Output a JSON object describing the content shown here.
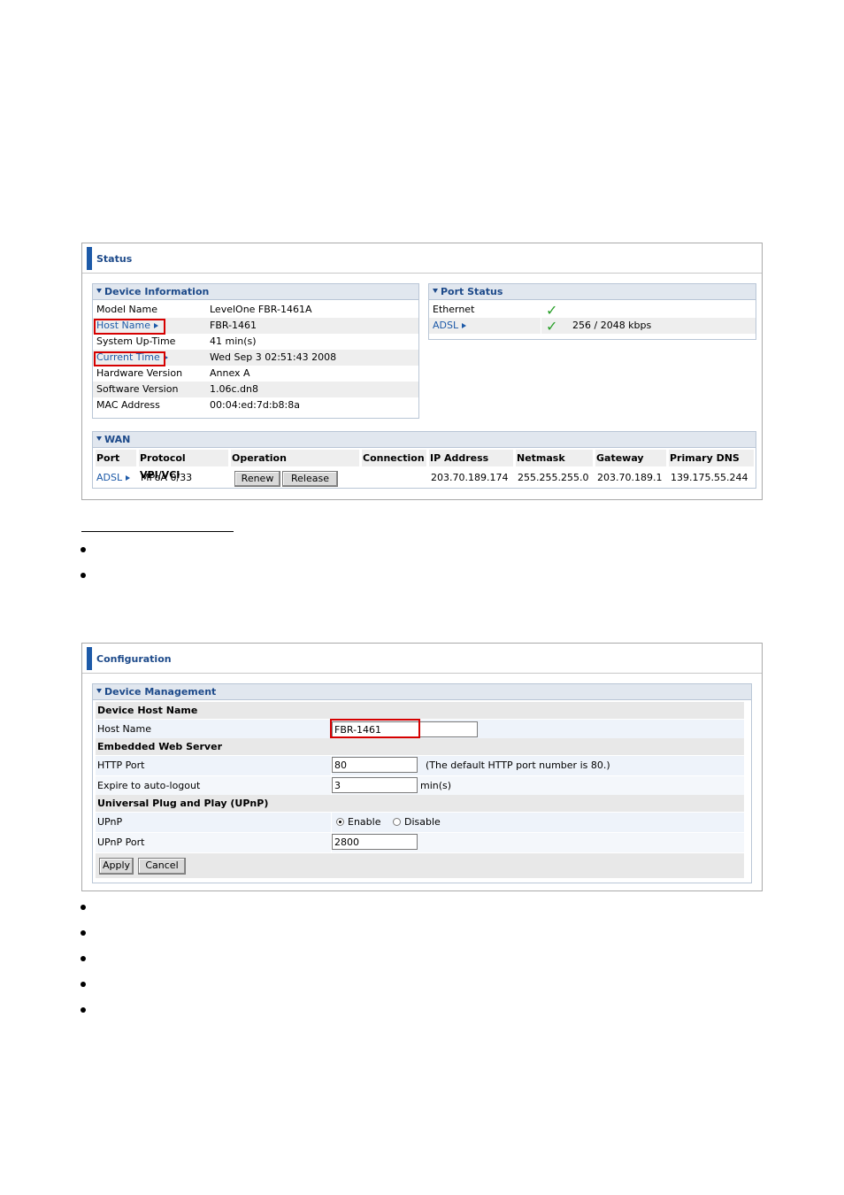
{
  "status_panel": {
    "title": "Status",
    "device_info": {
      "title": "Device Information",
      "rows": [
        {
          "label": "Model Name",
          "value": "LevelOne FBR-1461A"
        },
        {
          "label": "Host Name",
          "value": "FBR-1461"
        },
        {
          "label": "System Up-Time",
          "value": "41 min(s)"
        },
        {
          "label": "Current Time",
          "value": "Wed Sep 3 02:51:43 2008"
        },
        {
          "label": "Hardware Version",
          "value": "Annex A"
        },
        {
          "label": "Software Version",
          "value": "1.06c.dn8"
        },
        {
          "label": "MAC Address",
          "value": "00:04:ed:7d:b8:8a"
        }
      ]
    },
    "port_status": {
      "title": "Port Status",
      "rows": [
        {
          "label": "Ethernet",
          "value": ""
        },
        {
          "label": "ADSL",
          "value": "256 / 2048 kbps"
        }
      ],
      "check_glyph": "✓"
    },
    "wan": {
      "title": "WAN",
      "headers": [
        "Port",
        "Protocol VPI/VCI",
        "Operation",
        "Connection",
        "IP Address",
        "Netmask",
        "Gateway",
        "Primary DNS"
      ],
      "row": {
        "port": "ADSL",
        "protocol": "MPoA 0/33",
        "renew_label": "Renew",
        "release_label": "Release",
        "connection": "",
        "ip": "203.70.189.174",
        "netmask": "255.255.255.0",
        "gateway": "203.70.189.1",
        "dns": "139.175.55.244"
      }
    }
  },
  "config_panel": {
    "title": "Configuration",
    "section_title": "Device Management",
    "device_host_name": "Device Host Name",
    "host_name_label": "Host Name",
    "host_name_value": "FBR-1461",
    "embedded_web_server": "Embedded Web Server",
    "http_port_label": "HTTP Port",
    "http_port_value": "80",
    "http_port_note": "(The default HTTP port number is 80.)",
    "expire_label": "Expire to auto-logout",
    "expire_value": "3",
    "expire_unit": "min(s)",
    "upnp_section": "Universal Plug and Play (UPnP)",
    "upnp_label": "UPnP",
    "upnp_enable": "Enable",
    "upnp_disable": "Disable",
    "upnp_port_label": "UPnP Port",
    "upnp_port_value": "2800",
    "apply_label": "Apply",
    "cancel_label": "Cancel"
  },
  "colors": {
    "accent": "#1d5aa8",
    "highlight_box": "#d60000",
    "check": "#2aa02a"
  }
}
